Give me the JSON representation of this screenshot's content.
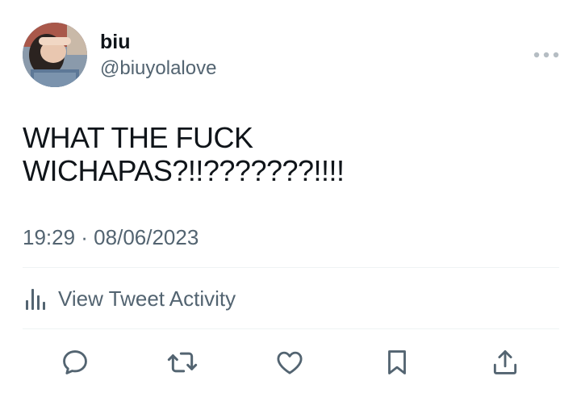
{
  "user": {
    "display_name": "biu",
    "handle": "@biuyolalove"
  },
  "tweet": {
    "text": "WHAT THE FUCK\nWICHAPAS?!!???????!!!!",
    "timestamp": "19:29 · 08/06/2023"
  },
  "activity": {
    "label": "View Tweet Activity",
    "icon": "bar-chart-icon"
  },
  "actions": [
    {
      "name": "reply",
      "icon": "comment-icon"
    },
    {
      "name": "retweet",
      "icon": "retweet-icon"
    },
    {
      "name": "like",
      "icon": "heart-icon"
    },
    {
      "name": "bookmark",
      "icon": "bookmark-icon"
    },
    {
      "name": "share",
      "icon": "share-icon"
    }
  ],
  "colors": {
    "text_primary": "#0f1419",
    "text_secondary": "#536471",
    "divider": "#eff3f4",
    "icon": "#536471"
  }
}
